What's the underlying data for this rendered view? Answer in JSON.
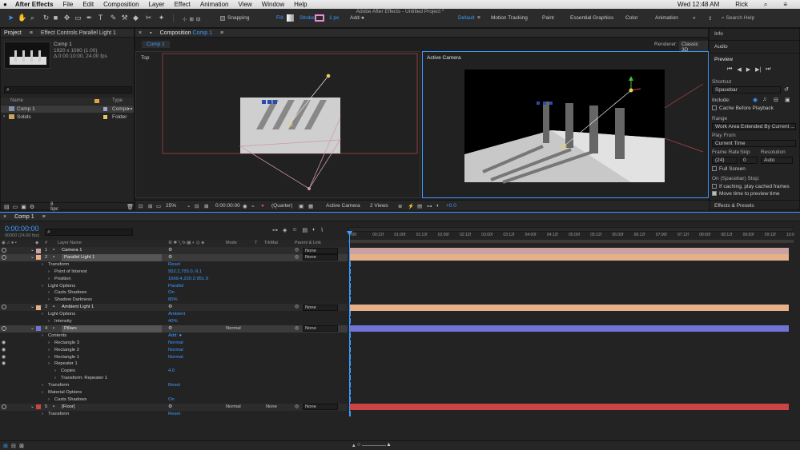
{
  "menubar": {
    "apple": "",
    "app": "After Effects",
    "items": [
      "File",
      "Edit",
      "Composition",
      "Layer",
      "Effect",
      "Animation",
      "View",
      "Window",
      "Help"
    ],
    "window_title": "Adobe After Effects - Untitled Project *",
    "clock": "Wed 12:48 AM",
    "user": "Rick"
  },
  "toolbar": {
    "snapping": "Snapping",
    "fill": "Fill:",
    "stroke": "Stroke:",
    "stroke_px": "1 px",
    "add": "Add:",
    "workspaces": [
      "Default",
      "Motion Tracking",
      "Paint",
      "Essential Graphics",
      "Color",
      "Animation"
    ],
    "search_placeholder": "Search Help"
  },
  "project": {
    "tab": "Project",
    "tab2": "Effect Controls Parallel Light 1",
    "comp_name": "Comp 1",
    "comp_info1": "1920 x 1080 (1.00)",
    "comp_info2": "Δ 0:00:10:00, 24.00 fps",
    "col_name": "Name",
    "col_type": "Type",
    "items": [
      {
        "name": "Comp 1",
        "type": "Compo",
        "color": "#9aa4c9"
      },
      {
        "name": "Solids",
        "type": "Folder",
        "color": "#e8c35a"
      }
    ],
    "bpc": "8 bpc"
  },
  "comp": {
    "tab": "Composition",
    "tab_name": "Comp 1",
    "subtab": "Comp 1",
    "renderer_label": "Renderer:",
    "renderer": "Classic 3D",
    "left_view": "Top",
    "right_view": "Active Camera",
    "zoom": "25%",
    "timecode": "0:00:00:00",
    "quality": "(Quarter)",
    "camera": "Active Camera",
    "views": "2 Views",
    "exposure": "+0.0"
  },
  "right": {
    "info": "Info",
    "audio": "Audio",
    "preview": "Preview",
    "shortcut_label": "Shortcut",
    "shortcut": "Spacebar",
    "include": "Include:",
    "cache_before": "Cache Before Playback",
    "range_label": "Range",
    "range": "Work Area Extended By Current ...",
    "playfrom_label": "Play From",
    "playfrom": "Current Time",
    "framerate": "Frame Rate",
    "skip": "Skip",
    "resolution": "Resolution",
    "fr_val": "(24)",
    "skip_val": "0",
    "res_val": "Auto",
    "fullscreen": "Full Screen",
    "onstop": "On (Spacebar) Stop:",
    "ifcaching": "If caching, play cached frames",
    "movetime": "Move time to preview time",
    "effects": "Effects & Presets"
  },
  "timeline": {
    "tab": "Comp 1",
    "timecode": "0:00:00:00",
    "fps": "00000 (24.00 fps)",
    "col_layer": "Layer Name",
    "col_mode": "Mode",
    "col_trkmat": "TrkMat",
    "col_parent": "Parent & Link",
    "rows": [
      {
        "kind": "layer",
        "num": "1",
        "name": "Camera 1",
        "color": "#c9a3a3",
        "parent": "None"
      },
      {
        "kind": "layer",
        "num": "2",
        "name": "Parallel Light 1",
        "color": "#e6b08a",
        "parent": "None",
        "selected": true
      },
      {
        "kind": "prop",
        "indent": 1,
        "name": "Transform",
        "value": "Reset"
      },
      {
        "kind": "prop",
        "indent": 2,
        "name": "Point of Interest",
        "value": "952.2,755.0,-9.1"
      },
      {
        "kind": "prop",
        "indent": 2,
        "name": "Position",
        "value": "1669.4,220.2,951.9"
      },
      {
        "kind": "prop",
        "indent": 1,
        "name": "Light Options",
        "value": "Parallel"
      },
      {
        "kind": "prop",
        "indent": 2,
        "name": "Casts Shadows",
        "value": "On"
      },
      {
        "kind": "prop",
        "indent": 2,
        "name": "Shadow Darkness",
        "value": "80%"
      },
      {
        "kind": "layer",
        "num": "3",
        "name": "Ambient Light 1",
        "color": "#e6b08a",
        "parent": "None"
      },
      {
        "kind": "prop",
        "indent": 1,
        "name": "Light Options",
        "value": "Ambient"
      },
      {
        "kind": "prop",
        "indent": 2,
        "name": "Intensity",
        "value": "40%"
      },
      {
        "kind": "layer",
        "num": "4",
        "name": "Pillars",
        "color": "#6f74d6",
        "parent": "None",
        "mode": "Normal",
        "selected": true
      },
      {
        "kind": "prop",
        "indent": 1,
        "name": "Contents",
        "value": "Add: ●"
      },
      {
        "kind": "prop",
        "indent": 2,
        "name": "Rectangle 3",
        "value": "Normal"
      },
      {
        "kind": "prop",
        "indent": 2,
        "name": "Rectangle 2",
        "value": "Normal"
      },
      {
        "kind": "prop",
        "indent": 2,
        "name": "Rectangle 1",
        "value": "Normal"
      },
      {
        "kind": "prop",
        "indent": 2,
        "name": "Repeater 1",
        "value": ""
      },
      {
        "kind": "prop",
        "indent": 3,
        "name": "Copies",
        "value": "4.0"
      },
      {
        "kind": "prop",
        "indent": 3,
        "name": "Transform: Repeater 1",
        "value": ""
      },
      {
        "kind": "prop",
        "indent": 1,
        "name": "Transform",
        "value": "Reset"
      },
      {
        "kind": "prop",
        "indent": 1,
        "name": "Material Options",
        "value": ""
      },
      {
        "kind": "prop",
        "indent": 2,
        "name": "Casts Shadows",
        "value": "On"
      },
      {
        "kind": "layer",
        "num": "5",
        "name": "[Floor]",
        "color": "#cc4444",
        "parent": "None",
        "mode": "Normal",
        "trkmat": "None"
      },
      {
        "kind": "prop",
        "indent": 1,
        "name": "Transform",
        "value": "Reset"
      }
    ],
    "ruler": [
      "00f",
      "00:12f",
      "01:00f",
      "01:12f",
      "02:00f",
      "02:12f",
      "03:00f",
      "03:12f",
      "04:00f",
      "04:12f",
      "05:00f",
      "05:12f",
      "06:00f",
      "06:12f",
      "07:00f",
      "07:12f",
      "08:00f",
      "08:12f",
      "09:00f",
      "09:12f",
      "10:0"
    ],
    "toggle": "Toggle Switches / Modes"
  },
  "colors": {
    "accent": "#3d9bff",
    "panel": "#232323",
    "layer_light": "#e6b08a",
    "layer_pillars": "#6f74d6",
    "layer_floor": "#cc4444"
  }
}
